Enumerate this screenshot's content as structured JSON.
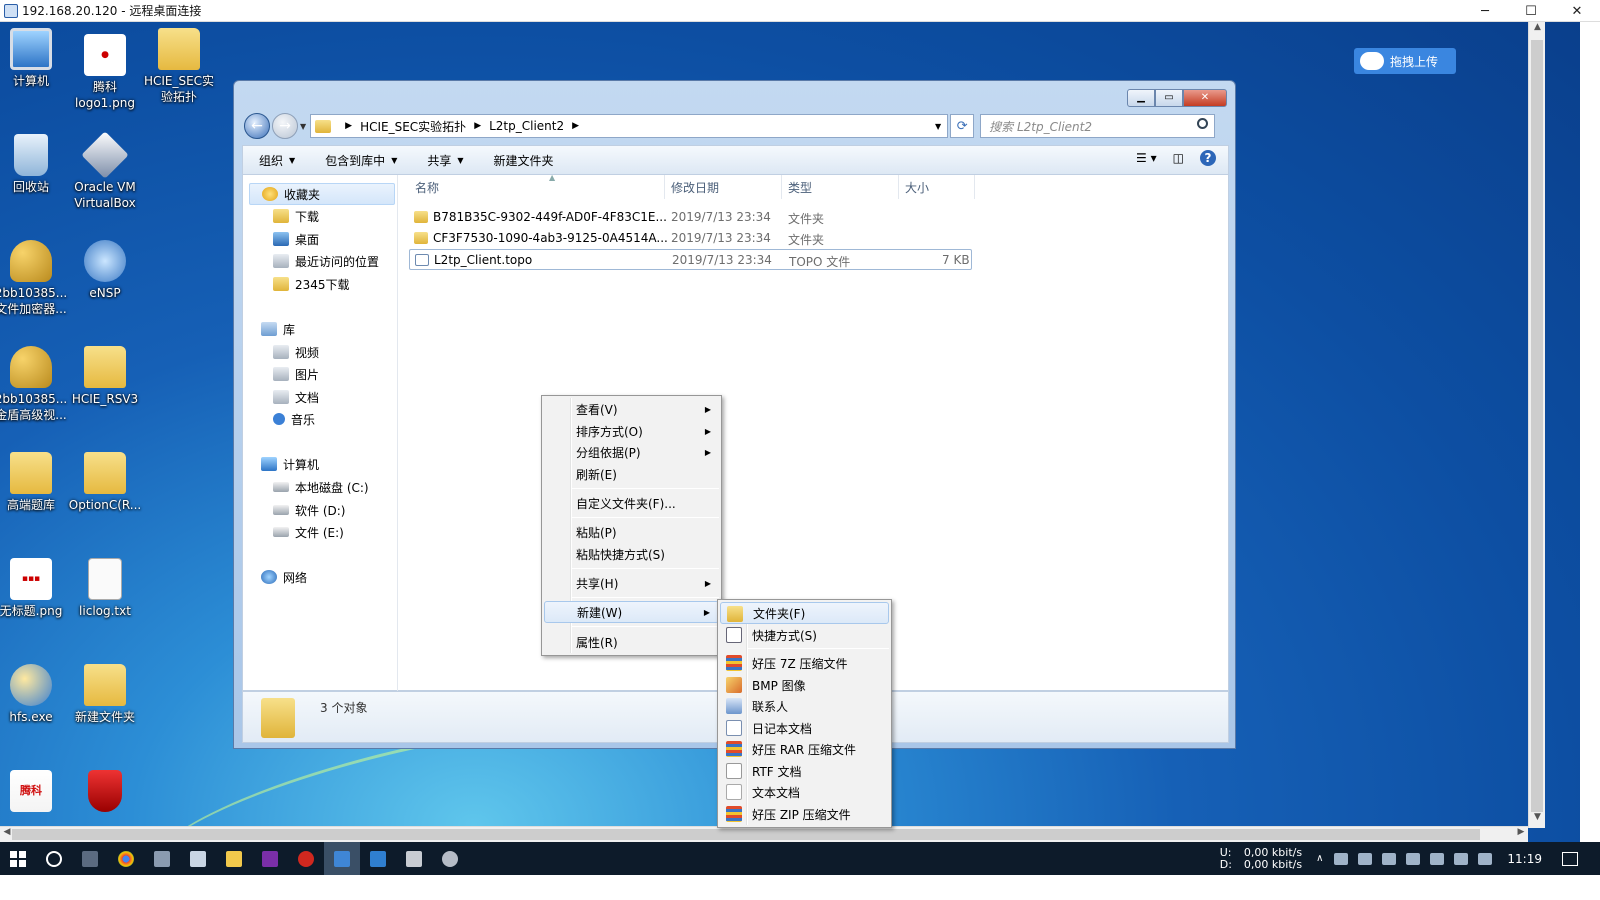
{
  "rdp": {
    "title": "192.168.20.120 - 远程桌面连接",
    "minimize": "─",
    "maximize": "☐",
    "close": "✕"
  },
  "desktop": {
    "icons": [
      {
        "label": "计算机",
        "icon": "computer-icon"
      },
      {
        "label": "腾科\nlogo1.png",
        "icon": "image-icon"
      },
      {
        "label": "HCIE_SEC实\n验拓扑",
        "icon": "folder-icon"
      },
      {
        "label": "回收站",
        "icon": "recycle-bin-icon"
      },
      {
        "label": "Oracle VM\nVirtualBox",
        "icon": "virtualbox-icon"
      },
      {
        "label": "2bb10385...\n文件加密器...",
        "icon": "keys-icon"
      },
      {
        "label": "eNSP",
        "icon": "ensp-icon"
      },
      {
        "label": "2bb10385...\n金盾高级视...",
        "icon": "keys-icon"
      },
      {
        "label": "HCIE_RSV3",
        "icon": "folder-icon"
      },
      {
        "label": "高端题库",
        "icon": "folder-icon"
      },
      {
        "label": "OptionC(R...",
        "icon": "folder-icon"
      },
      {
        "label": "无标题.png",
        "icon": "image-icon"
      },
      {
        "label": "liclog.txt",
        "icon": "text-file-icon"
      },
      {
        "label": "hfs.exe",
        "icon": "hfs-icon"
      },
      {
        "label": "新建文件夹",
        "icon": "folder-icon"
      },
      {
        "label": "腾科",
        "icon": "tengke-logo-icon"
      },
      {
        "label": "",
        "icon": "shield-app-icon"
      }
    ],
    "baidu_upload": "拖拽上传"
  },
  "explorer": {
    "breadcrumb": [
      "HCIE_SEC实验拓扑",
      "L2tp_Client2"
    ],
    "search_placeholder": "搜索 L2tp_Client2",
    "toolbar": {
      "organize": "组织",
      "include_library": "包含到库中",
      "share": "共享",
      "new_folder": "新建文件夹"
    },
    "nav": {
      "favorites": "收藏夹",
      "downloads": "下载",
      "desktop": "桌面",
      "recent": "最近访问的位置",
      "d2345": "2345下载",
      "libraries": "库",
      "videos": "视频",
      "pictures": "图片",
      "documents": "文档",
      "music": "音乐",
      "computer": "计算机",
      "drive_c": "本地磁盘 (C:)",
      "drive_d": "软件 (D:)",
      "drive_e": "文件 (E:)",
      "network": "网络"
    },
    "columns": {
      "name": "名称",
      "date": "修改日期",
      "type": "类型",
      "size": "大小"
    },
    "files": [
      {
        "name": "B781B35C-9302-449f-AD0F-4F83C1E...",
        "date": "2019/7/13 23:34",
        "type": "文件夹",
        "size": ""
      },
      {
        "name": "CF3F7530-1090-4ab3-9125-0A4514A...",
        "date": "2019/7/13 23:34",
        "type": "文件夹",
        "size": ""
      },
      {
        "name": "L2tp_Client.topo",
        "date": "2019/7/13 23:34",
        "type": "TOPO 文件",
        "size": "7 KB"
      }
    ],
    "status": "3 个对象"
  },
  "context_menu": {
    "view": "查看(V)",
    "sort": "排序方式(O)",
    "group": "分组依据(P)",
    "refresh": "刷新(E)",
    "customize": "自定义文件夹(F)...",
    "paste": "粘贴(P)",
    "paste_shortcut": "粘贴快捷方式(S)",
    "share": "共享(H)",
    "new": "新建(W)",
    "properties": "属性(R)"
  },
  "new_submenu": {
    "folder": "文件夹(F)",
    "shortcut": "快捷方式(S)",
    "7z": "好压 7Z 压缩文件",
    "bmp": "BMP 图像",
    "contact": "联系人",
    "journal": "日记本文档",
    "rar": "好压 RAR 压缩文件",
    "rtf": "RTF 文档",
    "txt": "文本文档",
    "zip": "好压 ZIP 压缩文件"
  },
  "taskbar": {
    "net_u": "U:",
    "net_d": "D:",
    "up_speed": "0,00 kbit/s",
    "down_speed": "0,00 kbit/s",
    "clock": "11:19"
  }
}
